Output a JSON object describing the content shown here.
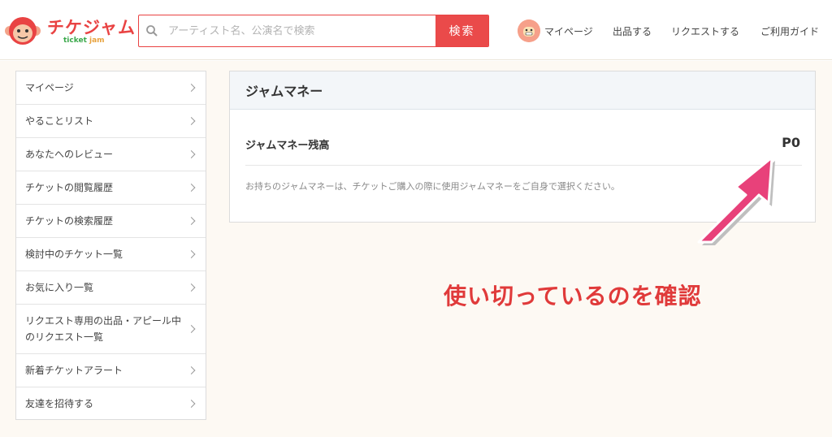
{
  "header": {
    "logo_text": "チケジャム",
    "logo_sub_ticket": "ticket",
    "logo_sub_jam": "jam",
    "search_placeholder": "アーティスト名、公演名で検索",
    "search_button": "検索",
    "nav": {
      "mypage": "マイページ",
      "sell": "出品する",
      "request": "リクエストする",
      "guide": "ご利用ガイド"
    }
  },
  "sidebar": {
    "items": [
      {
        "label": "マイページ"
      },
      {
        "label": "やることリスト"
      },
      {
        "label": "あなたへのレビュー"
      },
      {
        "label": "チケットの閲覧履歴"
      },
      {
        "label": "チケットの検索履歴"
      },
      {
        "label": "検討中のチケット一覧"
      },
      {
        "label": "お気に入り一覧"
      },
      {
        "label": "リクエスト専用の出品・アピール中のリクエスト一覧"
      },
      {
        "label": "新着チケットアラート"
      },
      {
        "label": "友達を招待する"
      }
    ]
  },
  "panel": {
    "title": "ジャムマネー",
    "balance_label": "ジャムマネー残高",
    "balance_value": "P0",
    "note": "お持ちのジャムマネーは、チケットご購入の際に使用ジャムマネーをご自身で選択ください。"
  },
  "annotation": {
    "text": "使い切っているのを確認"
  },
  "colors": {
    "brand_red": "#ea4a4a",
    "brand_green": "#3aa84a",
    "arrow_pink": "#e8417a",
    "annotation_red": "#e03a3a"
  }
}
